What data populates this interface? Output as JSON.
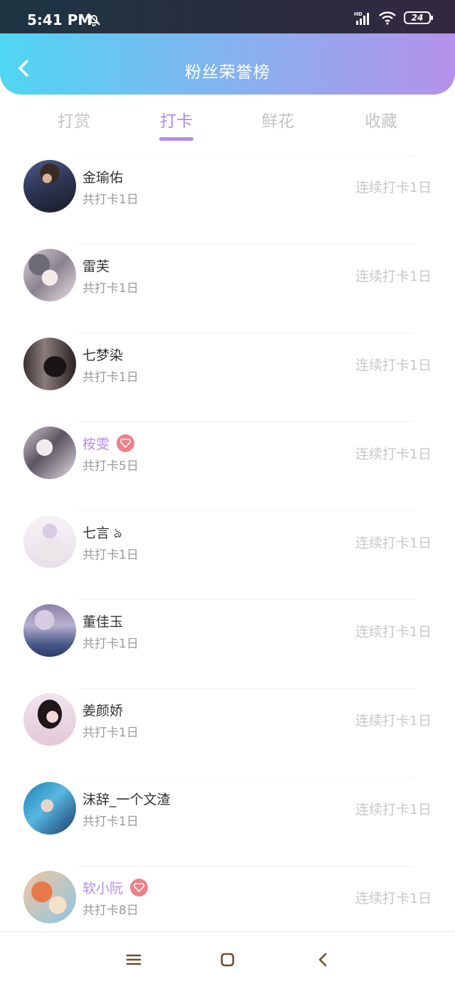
{
  "status": {
    "time": "5:41 PM",
    "battery": "24",
    "network": "HD"
  },
  "header": {
    "title": "粉丝荣誉榜"
  },
  "tabs": [
    "打赏",
    "打卡",
    "鲜花",
    "收藏"
  ],
  "active_tab": "打卡",
  "list": [
    {
      "name": "金瑜佑",
      "sub": "共打卡1日",
      "streak": "连续打卡1日",
      "vip": false
    },
    {
      "name": "雷芙",
      "sub": "共打卡1日",
      "streak": "连续打卡1日",
      "vip": false
    },
    {
      "name": "七梦染",
      "sub": "共打卡1日",
      "streak": "连续打卡1日",
      "vip": false
    },
    {
      "name": "桉雯",
      "sub": "共打卡5日",
      "streak": "连续打卡1日",
      "vip": true
    },
    {
      "name": "七言 ঌ",
      "sub": "共打卡1日",
      "streak": "连续打卡1日",
      "vip": false
    },
    {
      "name": "董佳玉",
      "sub": "共打卡1日",
      "streak": "连续打卡1日",
      "vip": false
    },
    {
      "name": "姜颜娇",
      "sub": "共打卡1日",
      "streak": "连续打卡1日",
      "vip": false
    },
    {
      "name": "沫辞_一个文渣",
      "sub": "共打卡1日",
      "streak": "连续打卡1日",
      "vip": false
    },
    {
      "name": "软小阮",
      "sub": "共打卡8日",
      "streak": "连续打卡1日",
      "vip": true
    }
  ],
  "colors": {
    "accent": "#b58be8",
    "vip_badge": "#ef7f86"
  }
}
